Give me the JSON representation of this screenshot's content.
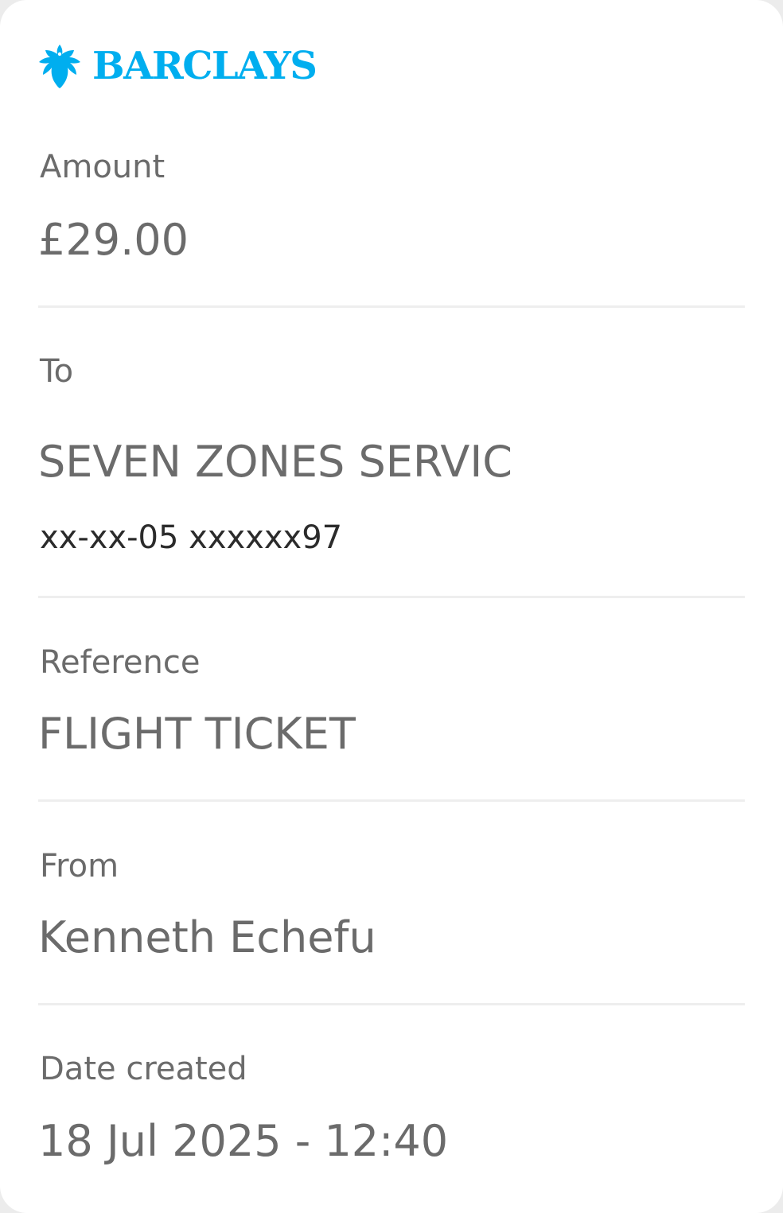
{
  "logo": {
    "text": "BARCLAYS",
    "icon": "eagle-icon",
    "color": "#00aeef"
  },
  "fields": {
    "amount": {
      "label": "Amount",
      "value": "£29.00"
    },
    "to": {
      "label": "To",
      "value": "SEVEN ZONES SERVIC",
      "account": "xx-xx-05 xxxxxx97"
    },
    "reference": {
      "label": "Reference",
      "value": "FLIGHT TICKET"
    },
    "from": {
      "label": "From",
      "value": "Kenneth Echefu"
    },
    "date_created": {
      "label": "Date created",
      "value": "18 Jul 2025 - 12:40"
    }
  }
}
